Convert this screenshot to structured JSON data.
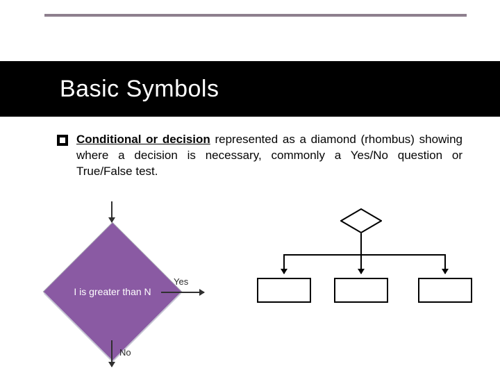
{
  "slide": {
    "title": "Basic Symbols"
  },
  "bullet": {
    "lead": "Conditional or decision",
    "rest": " represented as a diamond (rhombus) showing where a decision is necessary, commonly a Yes/No question or True/False test."
  },
  "left_example": {
    "diamond_text": "I is greater than N",
    "yes_label": "Yes",
    "no_label": "No"
  }
}
